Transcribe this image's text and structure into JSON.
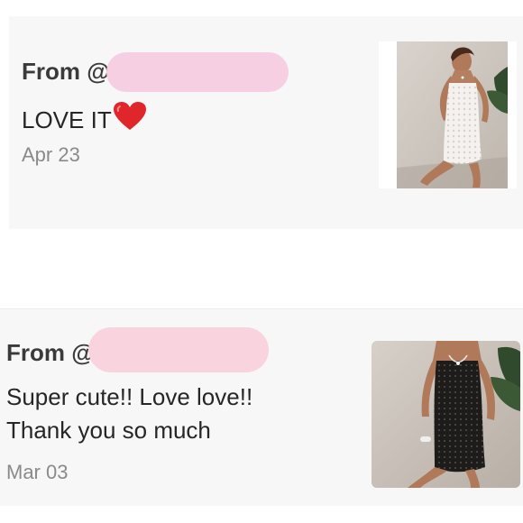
{
  "reviews": [
    {
      "from_label": "From @",
      "comment": "LOVE IT",
      "emoji": "heart-emoji",
      "date": "Apr 23",
      "image": "product-photo-white-lace-dress",
      "redaction_color": "#f7cfe3"
    },
    {
      "from_label": "From @",
      "comment_lines": [
        "Super cute!! Love love!!",
        "Thank you so much"
      ],
      "date": "Mar 03",
      "image": "product-photo-black-lace-dress",
      "redaction_color": "#f9d3dd"
    }
  ],
  "colors": {
    "card_bg": "#f8f7f8",
    "text_dark": "#262626",
    "text_muted": "#8a8a8a",
    "heart": "#e0262b"
  }
}
